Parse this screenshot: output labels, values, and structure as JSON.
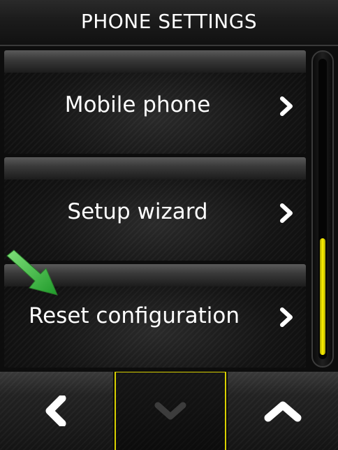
{
  "header": {
    "title": "PHONE SETTINGS"
  },
  "menu": {
    "items": [
      {
        "label": "Mobile phone",
        "icon": "chevron-right-icon"
      },
      {
        "label": "Setup wizard",
        "icon": "chevron-right-icon"
      },
      {
        "label": "Reset configuration",
        "icon": "chevron-right-icon"
      }
    ]
  },
  "scrollbar": {
    "position_fraction": 0.6,
    "visible_fraction": 0.4,
    "thumb_color": "#fff200"
  },
  "annotation": {
    "icon": "green-arrow-pointer-icon",
    "color": "#33b53a"
  },
  "bottom_nav": {
    "back": {
      "icon": "chevron-left-icon"
    },
    "down": {
      "icon": "chevron-down-icon",
      "enabled": false
    },
    "up": {
      "icon": "chevron-up-icon"
    }
  },
  "colors": {
    "accent": "#d9d100",
    "text": "#ffffff"
  }
}
